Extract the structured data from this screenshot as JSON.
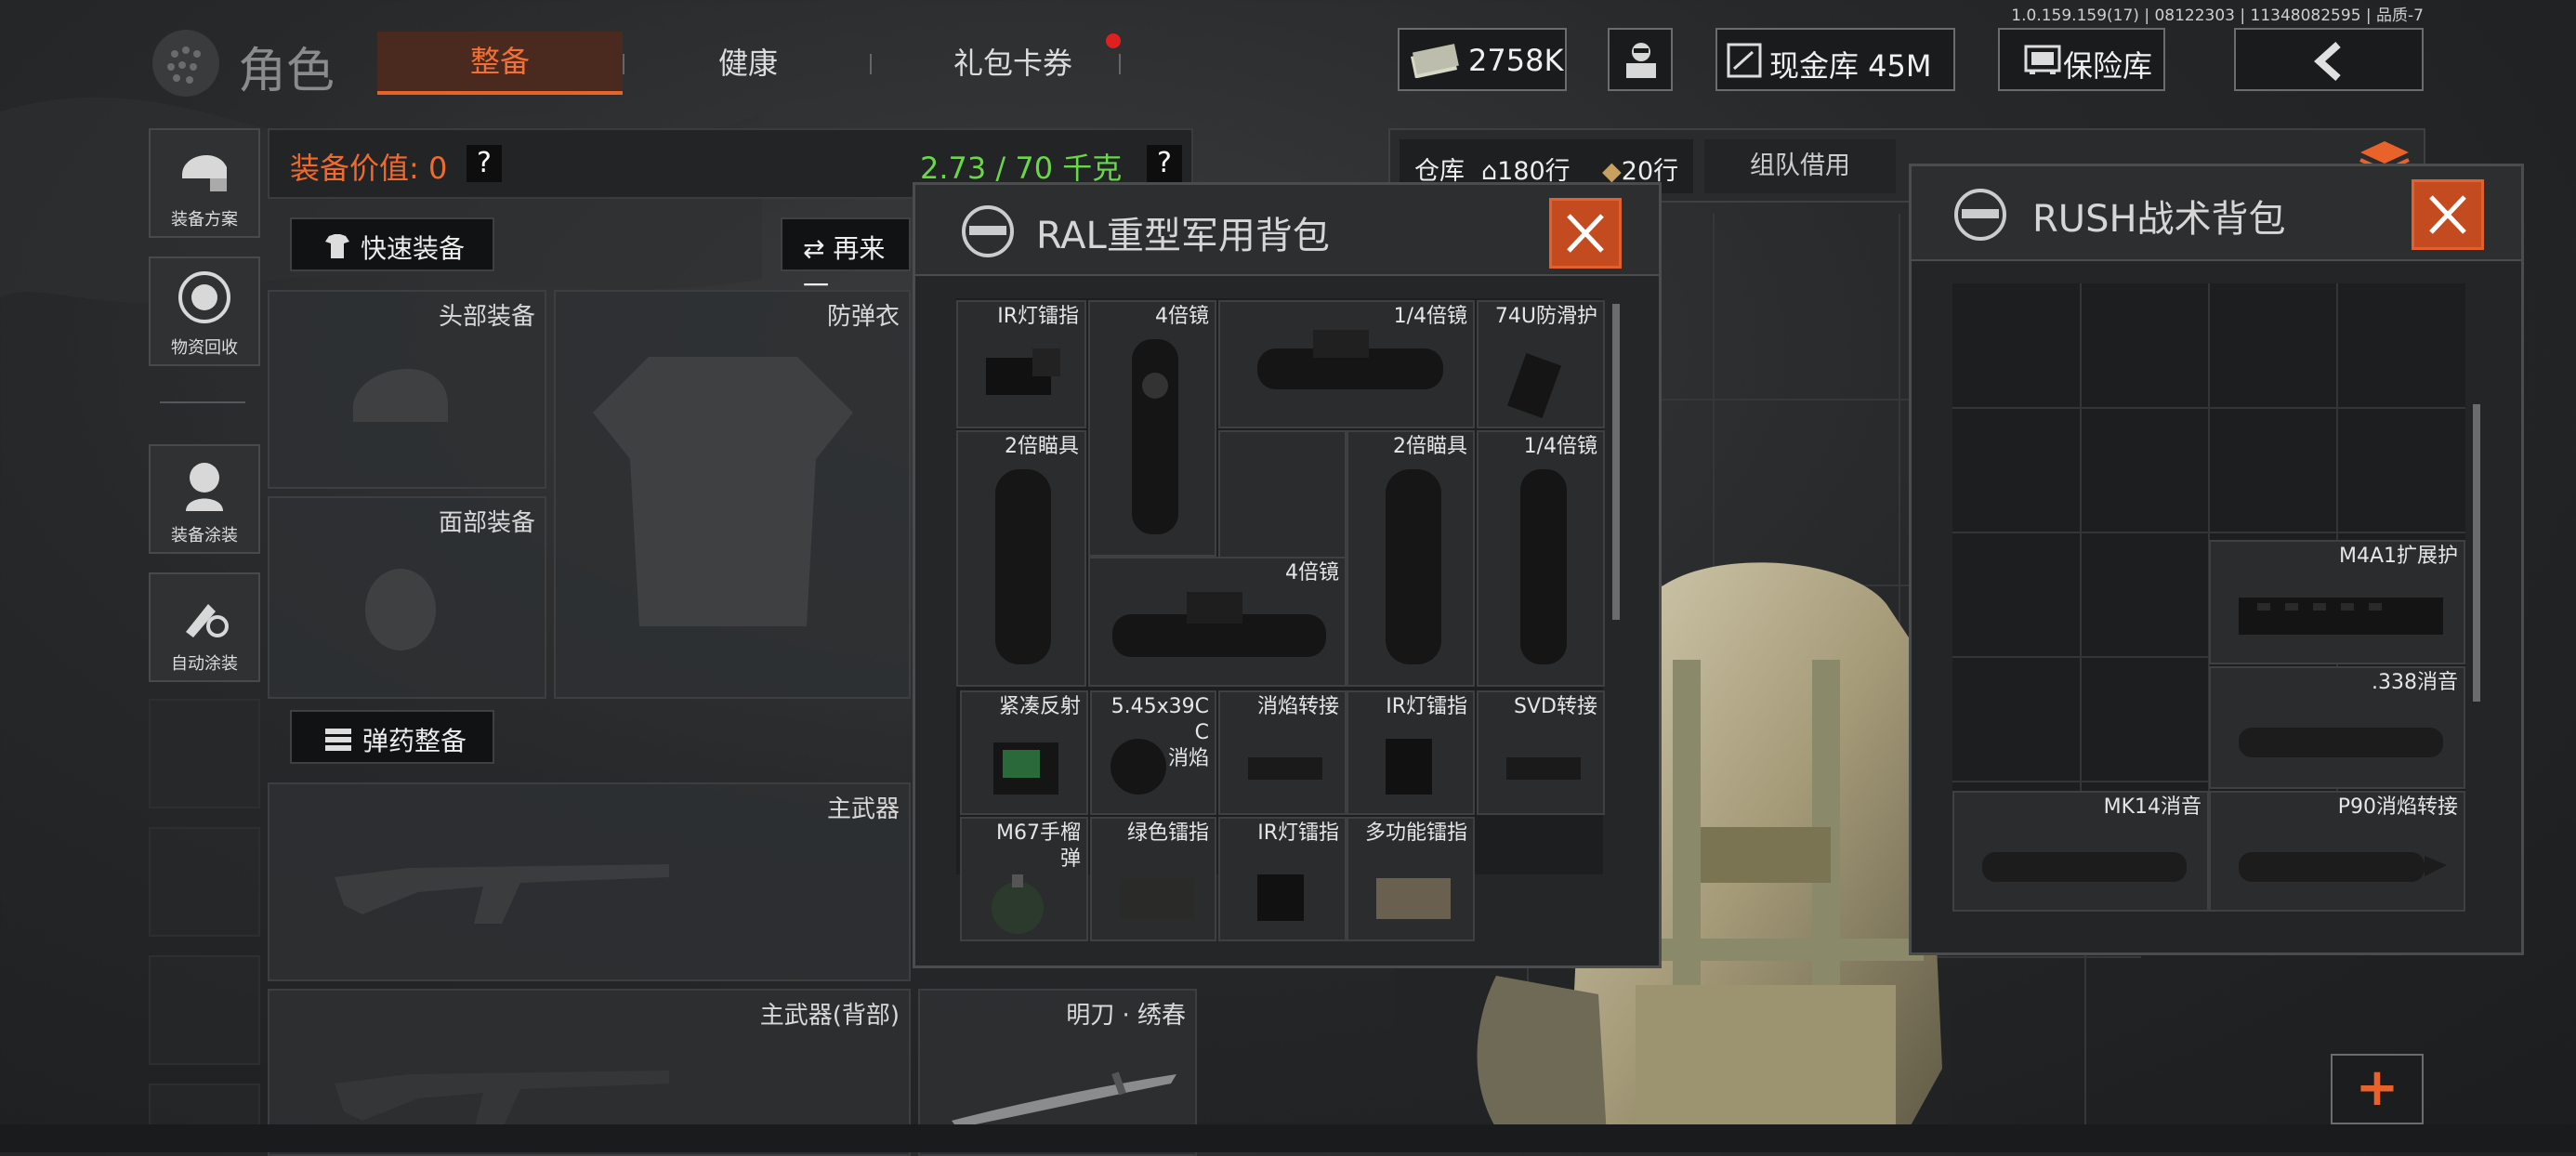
{
  "status_line": "1.0.159.159(17) | 08122303 | 11348082595 | 品质-7",
  "header": {
    "title": "角色",
    "tabs": [
      {
        "label": "整备",
        "active": true
      },
      {
        "label": "健康",
        "active": false
      },
      {
        "label": "礼包卡券",
        "active": false,
        "badge": true
      }
    ],
    "money": "2758K",
    "cash_vault": "现金库 45M",
    "safe_box": "保险库",
    "accent": "#e8622a"
  },
  "sidebar": [
    {
      "label": "装备方案",
      "icon": "helmet-icon"
    },
    {
      "label": "物资回收",
      "icon": "recycle-icon"
    },
    {
      "label": "装备涂装",
      "icon": "soldier-icon"
    },
    {
      "label": "自动涂装",
      "icon": "paint-icon"
    }
  ],
  "equipment": {
    "value_label": "装备价值: 0",
    "weight": "2.73 / 70 千克",
    "help": "?",
    "quick_equip": "快速装备",
    "again": "再来一",
    "ammo_equip": "弹药整备",
    "slots": {
      "head": "头部装备",
      "armor": "防弹衣",
      "face": "面部装备",
      "primary": "主武器",
      "primary_back": "主武器(背部)",
      "melee": "明刀 · 绣春"
    }
  },
  "warehouse": {
    "label": "仓库",
    "rows": "180行",
    "rows2": "20行",
    "team_borrow": "组队借用"
  },
  "ral_bag": {
    "title": "RAL重型军用背包",
    "items": [
      "IR灯镭指",
      "4倍镜",
      "1/4倍镜",
      "74U防滑护",
      "2倍瞄具",
      "2倍瞄具",
      "1/4倍镜",
      "4倍镜",
      "紧凑反射",
      "5.45x39C\nC\n消焰",
      "消焰转接",
      "IR灯镭指",
      "SVD转接",
      "M67手榴\n弹",
      "绿色镭指",
      "IR灯镭指",
      "多功能镭指"
    ]
  },
  "rush_bag": {
    "title": "RUSH战术背包",
    "items": [
      "M4A1扩展护",
      ".338消音",
      "MK14消音",
      "P90消焰转接"
    ]
  },
  "add_button": "+"
}
